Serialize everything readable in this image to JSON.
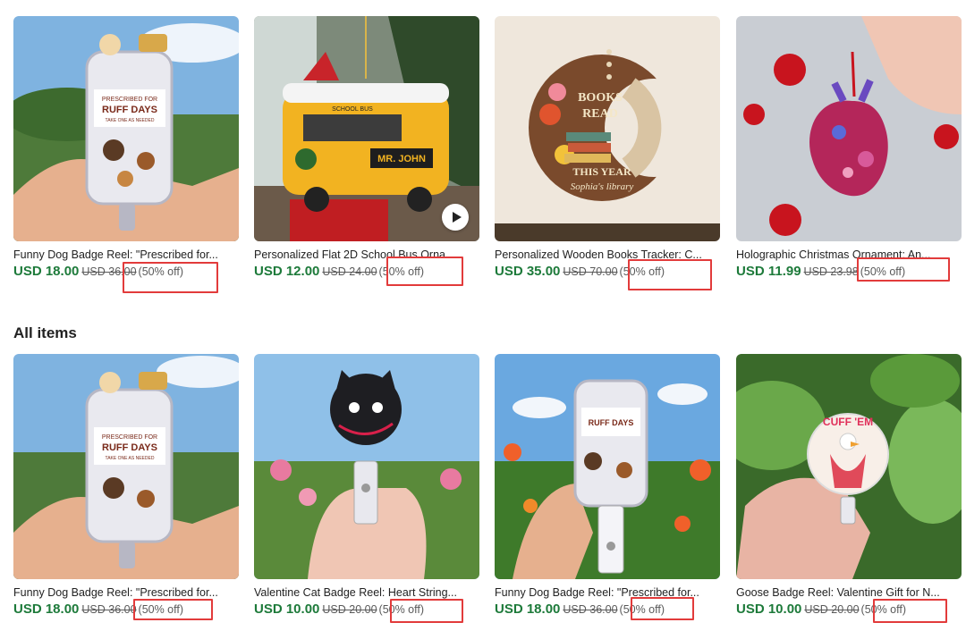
{
  "featured": [
    {
      "title": "Funny Dog Badge Reel: \"Prescribed for...",
      "price": "USD 18.00",
      "original": "USD 36.00",
      "discount": "(50% off)",
      "image": "dog-badge-reel"
    },
    {
      "title": "Personalized Flat 2D School Bus Orna...",
      "price": "USD 12.00",
      "original": "USD 24.00",
      "discount": "(50% off)",
      "image": "school-bus-ornament"
    },
    {
      "title": "Personalized Wooden Books Tracker: C...",
      "price": "USD 35.00",
      "original": "USD 70.00",
      "discount": "(50% off)",
      "image": "books-tracker"
    },
    {
      "title": "Holographic Christmas Ornament: An...",
      "price": "USD 11.99",
      "original": "USD 23.98",
      "discount": "(50% off)",
      "image": "heart-ornament"
    }
  ],
  "all_items_heading": "All items",
  "all_items": [
    {
      "title": "Funny Dog Badge Reel: \"Prescribed for...",
      "price": "USD 18.00",
      "original": "USD 36.00",
      "discount": "(50% off)",
      "image": "dog-badge-reel"
    },
    {
      "title": "Valentine Cat Badge Reel: Heart String...",
      "price": "USD 10.00",
      "original": "USD 20.00",
      "discount": "(50% off)",
      "image": "cat-badge-reel"
    },
    {
      "title": "Funny Dog Badge Reel: \"Prescribed for...",
      "price": "USD 18.00",
      "original": "USD 36.00",
      "discount": "(50% off)",
      "image": "dog-badge-reel-field"
    },
    {
      "title": "Goose Badge Reel: Valentine Gift for N...",
      "price": "USD 10.00",
      "original": "USD 20.00",
      "discount": "(50% off)",
      "image": "goose-badge-reel"
    }
  ],
  "image_text": {
    "jar_title": "PRESCRIBED FOR",
    "jar_big": "RUFF DAYS",
    "jar_sub": "TAKE ONE AS NEEDED",
    "bus_sign": "SCHOOL BUS",
    "bus_name": "MR. JOHN",
    "books_top": "BOOKS",
    "books_mid": "READ",
    "books_year": "THIS YEAR",
    "books_owner": "Sophia's library",
    "goose_text": "CUFF 'EM"
  },
  "colors": {
    "price": "#1d7a3a",
    "highlight": "#e23b3b"
  }
}
